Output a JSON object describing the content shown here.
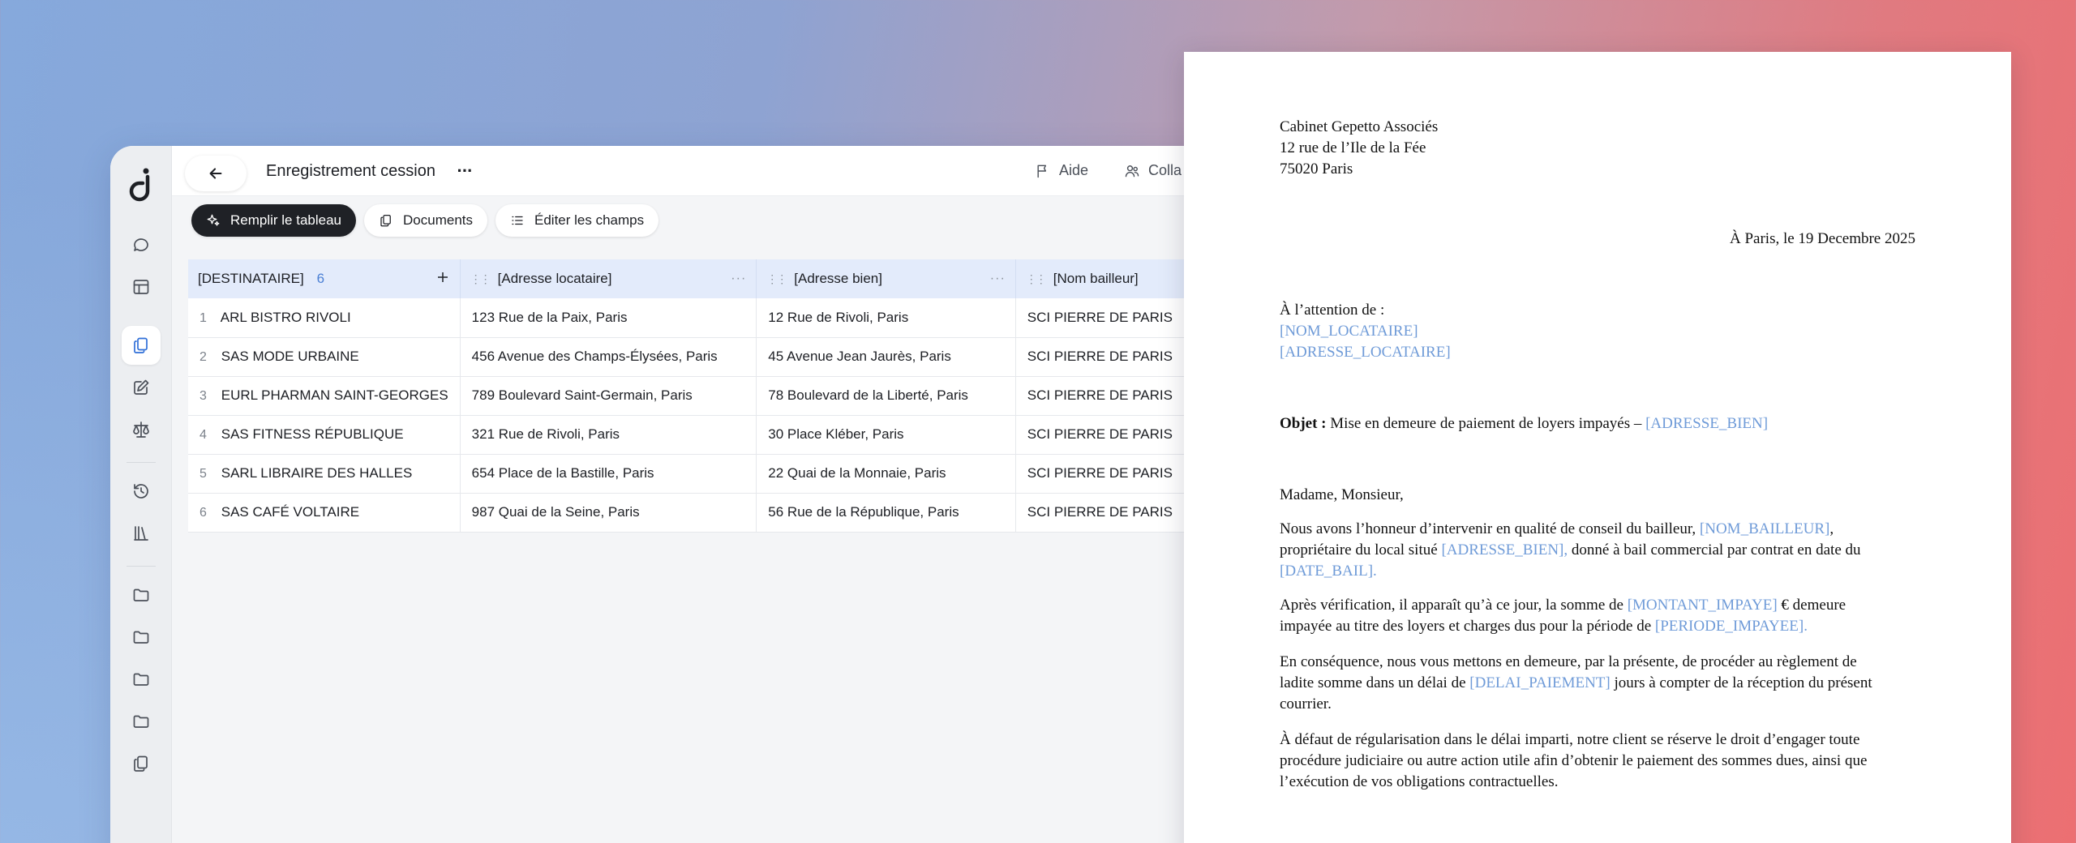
{
  "app": {
    "title": "Enregistrement cession",
    "more": "···",
    "help_label": "Aide",
    "collab_label": "Colla"
  },
  "sidebar": {
    "icons": [
      "chat-icon",
      "table-icon",
      "documents-icon",
      "edit-icon",
      "scale-icon",
      "history-icon",
      "library-icon",
      "folder-icon",
      "folder-icon",
      "folder-icon",
      "folder-icon",
      "documents-icon"
    ],
    "active": "documents-icon"
  },
  "toolbar": {
    "fill_label": "Remplir le tableau",
    "documents_label": "Documents",
    "edit_fields_label": "Éditer les champs"
  },
  "table": {
    "headers": [
      "[DESTINATAIRE]",
      "[Adresse locataire]",
      "[Adresse bien]",
      "[Nom bailleur]"
    ],
    "row_count": "6",
    "rows": [
      {
        "n": "1",
        "dest": "ARL BISTRO RIVOLI",
        "addr_loc": "123 Rue de la Paix, Paris",
        "addr_bien": "12 Rue de Rivoli, Paris",
        "bailleur": "SCI PIERRE DE PARIS"
      },
      {
        "n": "2",
        "dest": "SAS MODE URBAINE",
        "addr_loc": "456 Avenue des Champs-Élysées, Paris",
        "addr_bien": "45 Avenue Jean Jaurès, Paris",
        "bailleur": "SCI PIERRE DE PARIS"
      },
      {
        "n": "3",
        "dest": "EURL PHARMAN SAINT-GEORGES",
        "addr_loc": "789 Boulevard Saint-Germain, Paris",
        "addr_bien": "78 Boulevard de la Liberté, Paris",
        "bailleur": "SCI PIERRE DE PARIS"
      },
      {
        "n": "4",
        "dest": "SAS FITNESS RÉPUBLIQUE",
        "addr_loc": "321 Rue de Rivoli, Paris",
        "addr_bien": "30 Place Kléber, Paris",
        "bailleur": "SCI PIERRE DE PARIS"
      },
      {
        "n": "5",
        "dest": "SARL LIBRAIRE DES HALLES",
        "addr_loc": "654 Place de la Bastille, Paris",
        "addr_bien": "22 Quai de la Monnaie, Paris",
        "bailleur": "SCI PIERRE DE PARIS"
      },
      {
        "n": "6",
        "dest": "SAS CAFÉ VOLTAIRE",
        "addr_loc": "987 Quai de la Seine, Paris",
        "addr_bien": "56 Rue de la République, Paris",
        "bailleur": "SCI PIERRE DE PARIS"
      }
    ]
  },
  "doc": {
    "sender": [
      "Cabinet Gepetto Associés",
      "12 rue de l’Ile de la Fée",
      "75020 Paris"
    ],
    "date_line": "À Paris, le 19 Decembre 2025",
    "attention": "À l’attention de :",
    "var_nom_locataire": "[NOM_LOCATAIRE]",
    "var_adresse_locataire": "[ADRESSE_LOCATAIRE]",
    "objet_label": "Objet :",
    "objet_text": " Mise en demeure de paiement de loyers impayés – ",
    "var_adresse_bien": "[ADRESSE_BIEN]",
    "salutation": "Madame, Monsieur,",
    "p1_a": "Nous avons l’honneur d’intervenir en qualité de conseil du bailleur, ",
    "var_nom_bailleur": "[NOM_BAILLEUR]",
    "p1_b": ",",
    "p1_c": "propriétaire du local situé ",
    "var_adresse_bien_2": "[ADRESSE_BIEN],",
    "p1_d": " donné à bail commercial par contrat en date du",
    "var_date_bail": "[DATE_BAIL].",
    "p2_a": "Après vérification, il apparaît qu’à ce jour, la somme de ",
    "var_montant": "[MONTANT_IMPAYE]",
    "p2_b": " € demeure",
    "p2_c": "impayée au titre des loyers et charges dus pour la période de ",
    "var_periode": "[PERIODE_IMPAYEE].",
    "p3_a": "En conséquence, nous vous mettons en demeure, par la présente, de procéder au règlement de",
    "p3_b": "ladite somme dans un délai de ",
    "var_delai": "[DELAI_PAIEMENT]",
    "p3_c": " jours à compter de la réception du présent",
    "p3_d": "courrier.",
    "p4_a": "À défaut de régularisation dans le délai imparti, notre client se réserve le droit d’engager toute",
    "p4_b": "procédure judiciaire ou autre action utile afin d’obtenir le paiement des sommes dues, ainsi que",
    "p4_c": "l’exécution de vos obligations contractuelles."
  }
}
